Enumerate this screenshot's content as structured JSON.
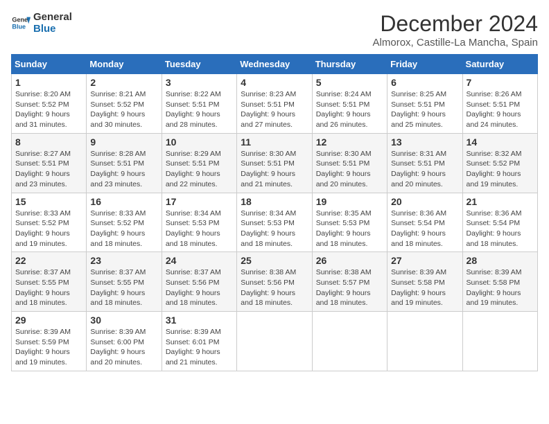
{
  "header": {
    "logo_line1": "General",
    "logo_line2": "Blue",
    "month": "December 2024",
    "location": "Almorox, Castille-La Mancha, Spain"
  },
  "weekdays": [
    "Sunday",
    "Monday",
    "Tuesday",
    "Wednesday",
    "Thursday",
    "Friday",
    "Saturday"
  ],
  "weeks": [
    [
      {
        "day": "1",
        "info": "Sunrise: 8:20 AM\nSunset: 5:52 PM\nDaylight: 9 hours\nand 31 minutes."
      },
      {
        "day": "2",
        "info": "Sunrise: 8:21 AM\nSunset: 5:52 PM\nDaylight: 9 hours\nand 30 minutes."
      },
      {
        "day": "3",
        "info": "Sunrise: 8:22 AM\nSunset: 5:51 PM\nDaylight: 9 hours\nand 28 minutes."
      },
      {
        "day": "4",
        "info": "Sunrise: 8:23 AM\nSunset: 5:51 PM\nDaylight: 9 hours\nand 27 minutes."
      },
      {
        "day": "5",
        "info": "Sunrise: 8:24 AM\nSunset: 5:51 PM\nDaylight: 9 hours\nand 26 minutes."
      },
      {
        "day": "6",
        "info": "Sunrise: 8:25 AM\nSunset: 5:51 PM\nDaylight: 9 hours\nand 25 minutes."
      },
      {
        "day": "7",
        "info": "Sunrise: 8:26 AM\nSunset: 5:51 PM\nDaylight: 9 hours\nand 24 minutes."
      }
    ],
    [
      {
        "day": "8",
        "info": "Sunrise: 8:27 AM\nSunset: 5:51 PM\nDaylight: 9 hours\nand 23 minutes."
      },
      {
        "day": "9",
        "info": "Sunrise: 8:28 AM\nSunset: 5:51 PM\nDaylight: 9 hours\nand 23 minutes."
      },
      {
        "day": "10",
        "info": "Sunrise: 8:29 AM\nSunset: 5:51 PM\nDaylight: 9 hours\nand 22 minutes."
      },
      {
        "day": "11",
        "info": "Sunrise: 8:30 AM\nSunset: 5:51 PM\nDaylight: 9 hours\nand 21 minutes."
      },
      {
        "day": "12",
        "info": "Sunrise: 8:30 AM\nSunset: 5:51 PM\nDaylight: 9 hours\nand 20 minutes."
      },
      {
        "day": "13",
        "info": "Sunrise: 8:31 AM\nSunset: 5:51 PM\nDaylight: 9 hours\nand 20 minutes."
      },
      {
        "day": "14",
        "info": "Sunrise: 8:32 AM\nSunset: 5:52 PM\nDaylight: 9 hours\nand 19 minutes."
      }
    ],
    [
      {
        "day": "15",
        "info": "Sunrise: 8:33 AM\nSunset: 5:52 PM\nDaylight: 9 hours\nand 19 minutes."
      },
      {
        "day": "16",
        "info": "Sunrise: 8:33 AM\nSunset: 5:52 PM\nDaylight: 9 hours\nand 18 minutes."
      },
      {
        "day": "17",
        "info": "Sunrise: 8:34 AM\nSunset: 5:53 PM\nDaylight: 9 hours\nand 18 minutes."
      },
      {
        "day": "18",
        "info": "Sunrise: 8:34 AM\nSunset: 5:53 PM\nDaylight: 9 hours\nand 18 minutes."
      },
      {
        "day": "19",
        "info": "Sunrise: 8:35 AM\nSunset: 5:53 PM\nDaylight: 9 hours\nand 18 minutes."
      },
      {
        "day": "20",
        "info": "Sunrise: 8:36 AM\nSunset: 5:54 PM\nDaylight: 9 hours\nand 18 minutes."
      },
      {
        "day": "21",
        "info": "Sunrise: 8:36 AM\nSunset: 5:54 PM\nDaylight: 9 hours\nand 18 minutes."
      }
    ],
    [
      {
        "day": "22",
        "info": "Sunrise: 8:37 AM\nSunset: 5:55 PM\nDaylight: 9 hours\nand 18 minutes."
      },
      {
        "day": "23",
        "info": "Sunrise: 8:37 AM\nSunset: 5:55 PM\nDaylight: 9 hours\nand 18 minutes."
      },
      {
        "day": "24",
        "info": "Sunrise: 8:37 AM\nSunset: 5:56 PM\nDaylight: 9 hours\nand 18 minutes."
      },
      {
        "day": "25",
        "info": "Sunrise: 8:38 AM\nSunset: 5:56 PM\nDaylight: 9 hours\nand 18 minutes."
      },
      {
        "day": "26",
        "info": "Sunrise: 8:38 AM\nSunset: 5:57 PM\nDaylight: 9 hours\nand 18 minutes."
      },
      {
        "day": "27",
        "info": "Sunrise: 8:39 AM\nSunset: 5:58 PM\nDaylight: 9 hours\nand 19 minutes."
      },
      {
        "day": "28",
        "info": "Sunrise: 8:39 AM\nSunset: 5:58 PM\nDaylight: 9 hours\nand 19 minutes."
      }
    ],
    [
      {
        "day": "29",
        "info": "Sunrise: 8:39 AM\nSunset: 5:59 PM\nDaylight: 9 hours\nand 19 minutes."
      },
      {
        "day": "30",
        "info": "Sunrise: 8:39 AM\nSunset: 6:00 PM\nDaylight: 9 hours\nand 20 minutes."
      },
      {
        "day": "31",
        "info": "Sunrise: 8:39 AM\nSunset: 6:01 PM\nDaylight: 9 hours\nand 21 minutes."
      },
      {
        "day": "",
        "info": ""
      },
      {
        "day": "",
        "info": ""
      },
      {
        "day": "",
        "info": ""
      },
      {
        "day": "",
        "info": ""
      }
    ]
  ]
}
